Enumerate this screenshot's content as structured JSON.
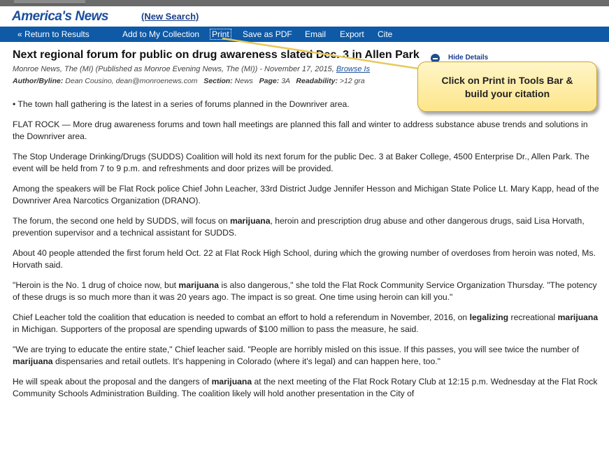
{
  "header": {
    "brand": "America's News",
    "new_search": "(New Search)"
  },
  "toolbar": {
    "return_icon": "double-chevron-left-icon",
    "return_label": "Return to Results",
    "add_collection": "Add to My Collection",
    "print": "Print",
    "save_pdf": "Save as PDF",
    "email": "Email",
    "export": "Export",
    "cite": "Cite"
  },
  "article": {
    "title": "Next regional forum for public on drug awareness slated Dec. 3 in Allen Park",
    "hide_details": "Hide Details",
    "source": "Monroe News, The (MI) (Published as Monroe Evening News, The (MI)) - November 17, 2015",
    "browse_link": "Browse Is",
    "author_label": "Author/Byline:",
    "author": "Dean Cousino, dean@monroenews.com",
    "section_label": "Section:",
    "section": "News",
    "page_label": "Page:",
    "page": "3A",
    "readability_label": "Readability:",
    "readability": ">12 gra",
    "paragraphs": [
      [
        {
          "t": "• The town hall gathering is the latest in a series of forums planned in the Downriver area.",
          "b": false
        }
      ],
      [
        {
          "t": "FLAT ROCK — More drug awareness forums and town hall meetings are planned this fall and winter to address substance abuse trends and solutions in the Downriver area.",
          "b": false
        }
      ],
      [
        {
          "t": "The Stop Underage Drinking/Drugs (SUDDS) Coalition will hold its next forum for the public Dec. 3 at Baker College, 4500 Enterprise Dr., Allen Park. The event will be held from 7 to 9 p.m. and refreshments and door prizes will be provided.",
          "b": false
        }
      ],
      [
        {
          "t": "Among the speakers will be Flat Rock police Chief John Leacher, 33rd District Judge Jennifer Hesson and Michigan State Police Lt. Mary Kapp, head of the Downriver Area Narcotics Organization (DRANO).",
          "b": false
        }
      ],
      [
        {
          "t": "The forum, the second one held by SUDDS, will focus on ",
          "b": false
        },
        {
          "t": "marijuana",
          "b": true
        },
        {
          "t": ", heroin and prescription drug abuse and other dangerous drugs, said Lisa Horvath, prevention supervisor and a technical assistant for SUDDS.",
          "b": false
        }
      ],
      [
        {
          "t": "About 40 people attended the first forum held Oct. 22 at Flat Rock High School, during which the growing number of overdoses from heroin was noted, Ms. Horvath said.",
          "b": false
        }
      ],
      [
        {
          "t": "\"Heroin is the No. 1 drug of choice now, but ",
          "b": false
        },
        {
          "t": "marijuana",
          "b": true
        },
        {
          "t": " is also dangerous,\" she told the Flat Rock Community Service Organization Thursday. \"The potency of these drugs is so much more than it was 20 years ago. The impact is so great. One time using heroin can kill you.\"",
          "b": false
        }
      ],
      [
        {
          "t": "Chief Leacher told the coalition that education is needed to combat an effort to hold a referendum in November, 2016, on ",
          "b": false
        },
        {
          "t": "legalizing",
          "b": true
        },
        {
          "t": " recreational ",
          "b": false
        },
        {
          "t": "marijuana",
          "b": true
        },
        {
          "t": " in Michigan. Supporters of the proposal are spending upwards of $100 million to pass the measure, he said.",
          "b": false
        }
      ],
      [
        {
          "t": "\"We are trying to educate the entire state,\" Chief leacher said. \"People are horribly misled on this issue. If this passes, you will see twice the number of ",
          "b": false
        },
        {
          "t": "marijuana",
          "b": true
        },
        {
          "t": " dispensaries and retail outlets. It's happening in Colorado (where it's legal) and can happen here, too.\"",
          "b": false
        }
      ],
      [
        {
          "t": "He will speak about the proposal and the dangers of ",
          "b": false
        },
        {
          "t": "marijuana",
          "b": true
        },
        {
          "t": " at the next meeting of the Flat Rock Rotary Club at 12:15 p.m. Wednesday at the Flat Rock Community Schools Administration Building. The coalition likely will hold another presentation in the City of",
          "b": false
        }
      ]
    ]
  },
  "callout": {
    "line1": "Click on Print in Tools Bar &",
    "line2": "build your citation"
  },
  "colors": {
    "toolbar": "#0e5aa7",
    "brand": "#1a4f9c",
    "callout_fill": "#fde58a",
    "callout_border": "#c9a43a"
  }
}
